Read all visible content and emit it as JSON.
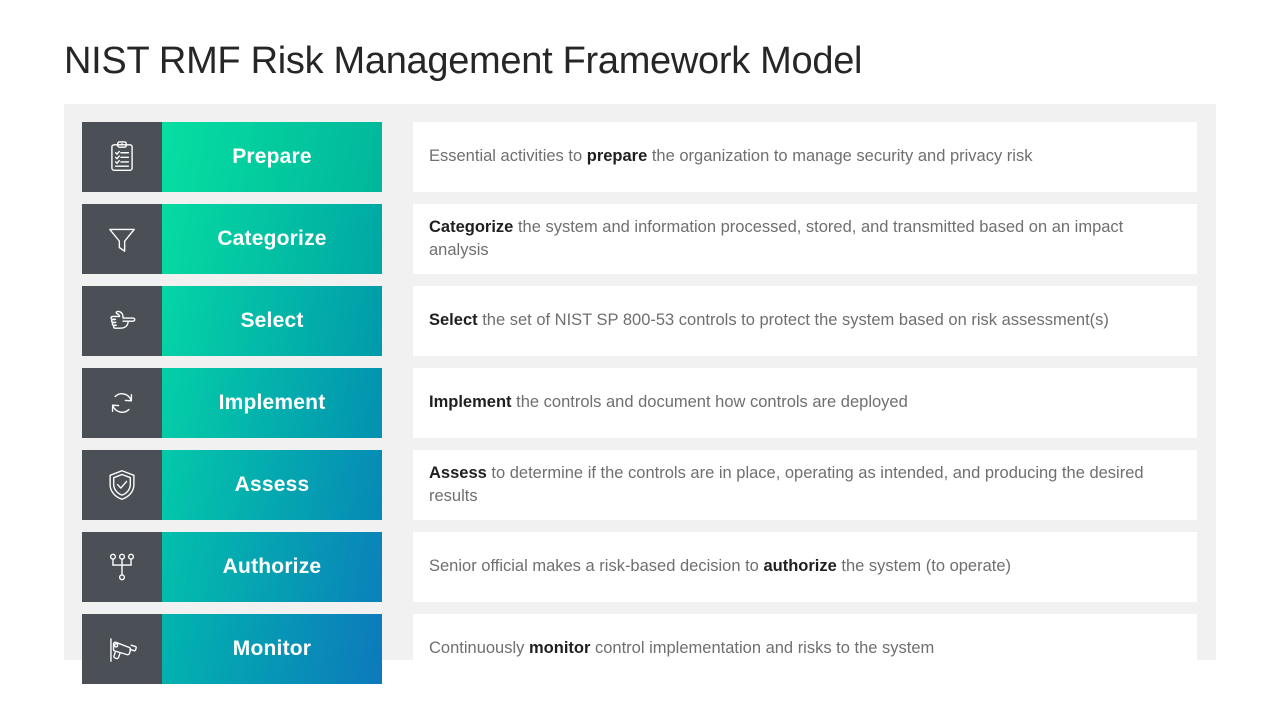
{
  "page": {
    "title": "NIST RMF Risk Management Framework Model"
  },
  "theme": {
    "icon_box_color": "#4b5057",
    "panel_background": "#f1f1f1",
    "card_background": "#ffffff",
    "body_text_color": "#6f6f6f",
    "emphasis_text_color": "#1f1f1f",
    "gradient_start_first": "#00dfa0",
    "gradient_end_last": "#0b7fb5"
  },
  "steps": [
    {
      "label": "Prepare",
      "icon": "clipboard-checklist-icon",
      "gradient_from": "#06dfa2",
      "gradient_to": "#01b69b",
      "description_parts": [
        {
          "text": "Essential activities to ",
          "bold": false
        },
        {
          "text": "prepare",
          "bold": true
        },
        {
          "text": " the organization to manage security and privacy risk",
          "bold": false
        }
      ]
    },
    {
      "label": "Categorize",
      "icon": "funnel-filter-icon",
      "gradient_from": "#06dba2",
      "gradient_to": "#00a7a4",
      "description_parts": [
        {
          "text": "Categorize",
          "bold": true
        },
        {
          "text": " the system and information processed, stored,  and transmitted based on an impact analysis",
          "bold": false
        }
      ]
    },
    {
      "label": "Select",
      "icon": "pointing-hand-icon",
      "gradient_from": "#05d5a5",
      "gradient_to": "#019aab",
      "description_parts": [
        {
          "text": "Select",
          "bold": true
        },
        {
          "text": " the set of NIST SP 800-53 controls to protect the system based on risk assessment(s)",
          "bold": false
        }
      ]
    },
    {
      "label": "Implement",
      "icon": "cycle-arrows-icon",
      "gradient_from": "#04cfa7",
      "gradient_to": "#0391b1",
      "description_parts": [
        {
          "text": "Implement",
          "bold": true
        },
        {
          "text": " the controls and document how controls are deployed",
          "bold": false
        }
      ]
    },
    {
      "label": "Assess",
      "icon": "shield-check-icon",
      "gradient_from": "#03c9a9",
      "gradient_to": "#0689b6",
      "description_parts": [
        {
          "text": "Assess",
          "bold": true
        },
        {
          "text": " to determine if the controls are in place, operating as intended, and producing the desired results",
          "bold": false
        }
      ]
    },
    {
      "label": "Authorize",
      "icon": "hierarchy-nodes-icon",
      "gradient_from": "#02c0ab",
      "gradient_to": "#0a81ba",
      "description_parts": [
        {
          "text": "Senior official makes a risk-based decision to ",
          "bold": false
        },
        {
          "text": "authorize",
          "bold": true
        },
        {
          "text": " the system (to operate)",
          "bold": false
        }
      ]
    },
    {
      "label": "Monitor",
      "icon": "security-camera-icon",
      "gradient_from": "#01b5ae",
      "gradient_to": "#0d79bc",
      "description_parts": [
        {
          "text": "Continuously ",
          "bold": false
        },
        {
          "text": "monitor",
          "bold": true
        },
        {
          "text": " control implementation and risks to the system",
          "bold": false
        }
      ]
    }
  ]
}
